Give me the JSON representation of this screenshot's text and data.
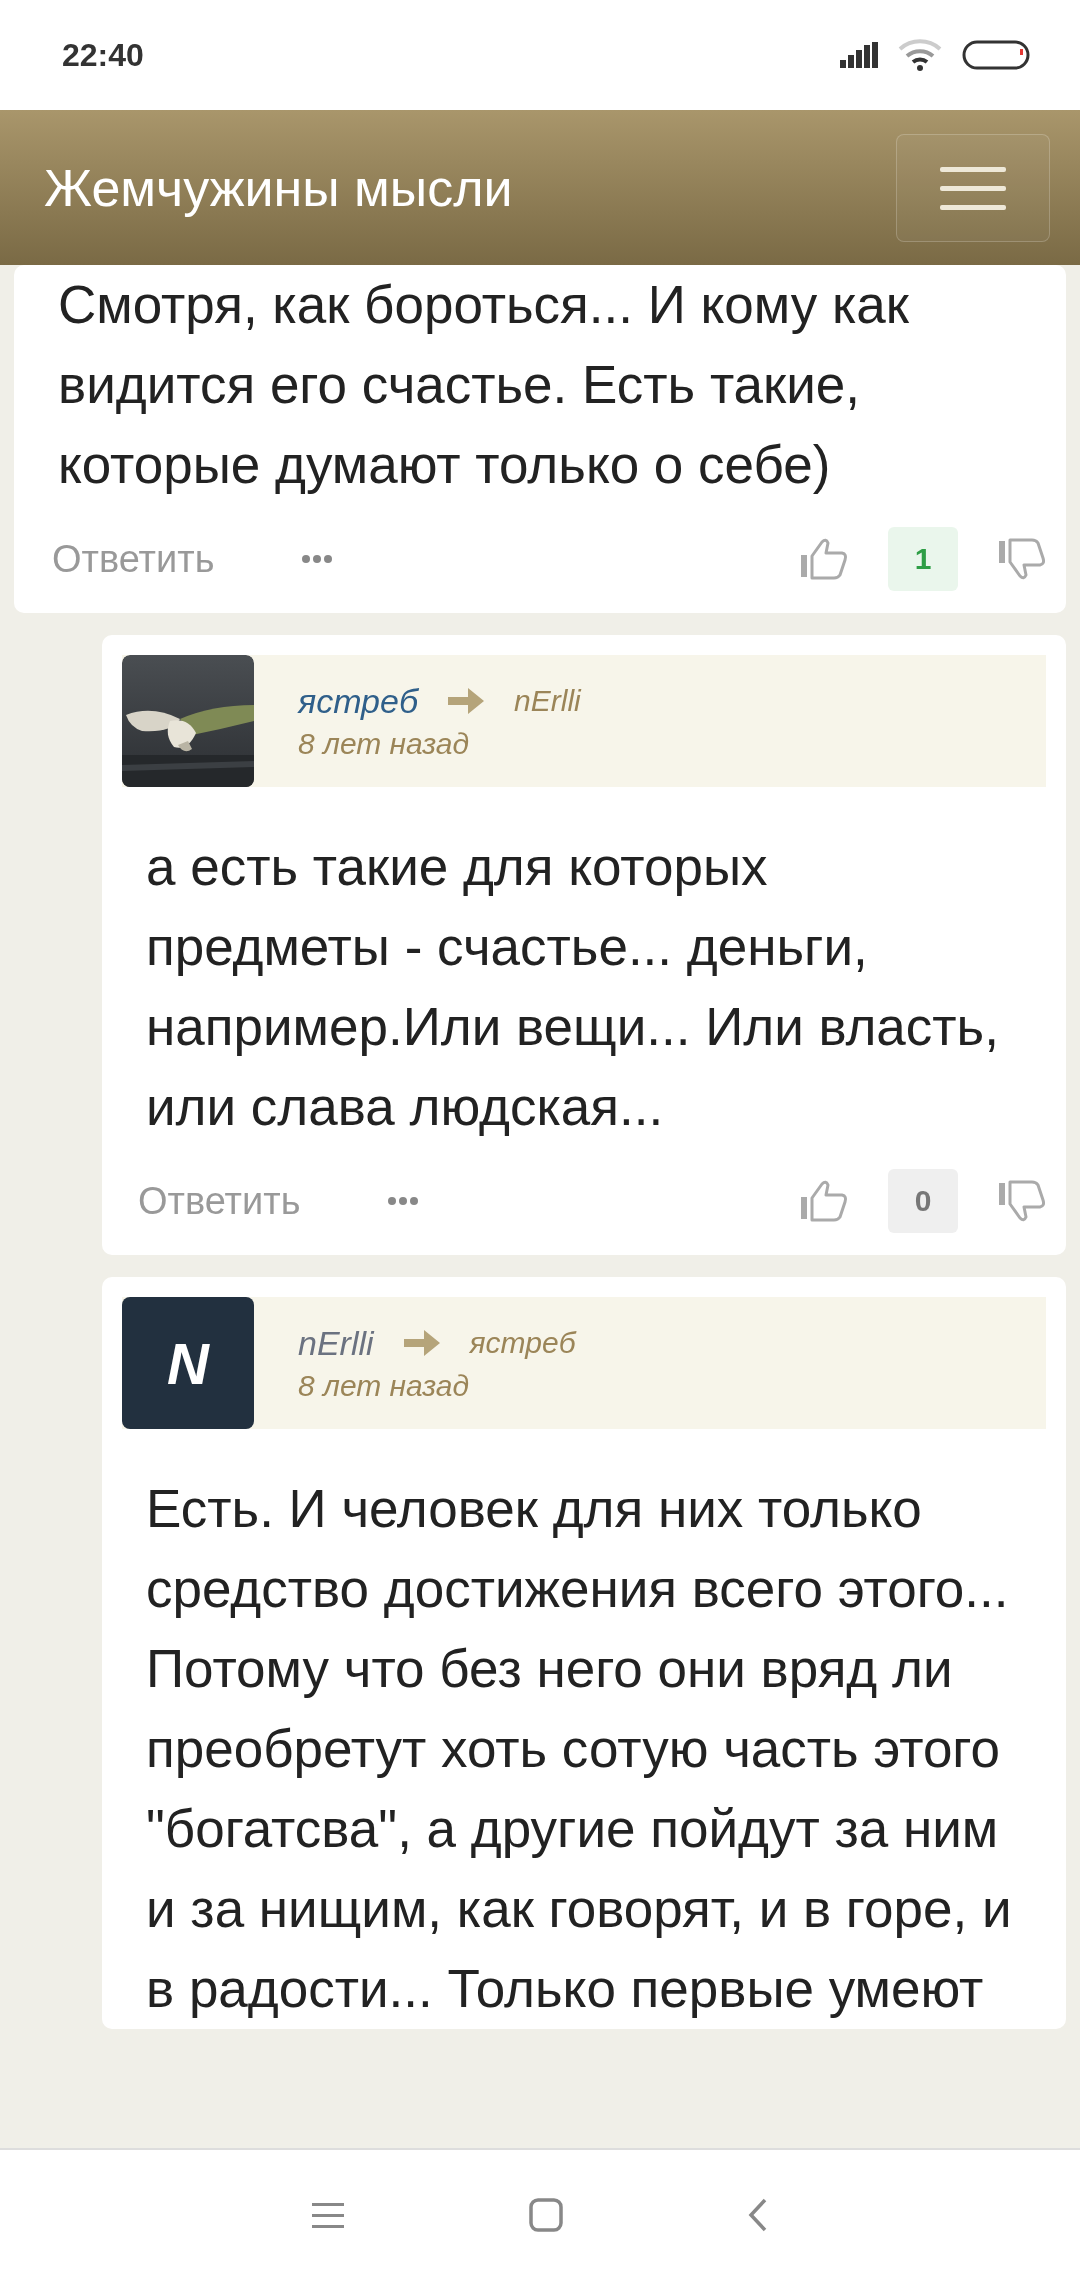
{
  "status_bar": {
    "time": "22:40"
  },
  "header": {
    "title": "Жемчужины мысли"
  },
  "comments": [
    {
      "kind": "partial",
      "text": "Смотря, как бороться... И кому как видится его счастье. Есть такие, которые думают только о себе)",
      "reply": "Ответить",
      "score": "1",
      "highlighted": true
    },
    {
      "kind": "reply",
      "author": {
        "name": "ястреб",
        "color": "#2f5f8a"
      },
      "to": "nErlli",
      "time": "8 лет назад",
      "text": "а есть такие для которых предметы - счастье... деньги, например.Или вещи... Или власть, или слава людская...",
      "reply": "Ответить",
      "score": "0",
      "highlighted": false
    },
    {
      "kind": "reply",
      "avatar": {
        "kind": "letter",
        "letter": "N"
      },
      "author": {
        "name": "nErlli",
        "color": "#6b7280"
      },
      "to": "ястреб",
      "time": "8 лет назад",
      "text": "Есть. И человек для них только средство достижения всего этого... Потому что без него они вряд ли преобретут хоть сотую часть этого \"богатсва\", а другие пойдут за ним и за нищим, как говорят, и в горе, и в радости... Только первые умеют"
    }
  ]
}
